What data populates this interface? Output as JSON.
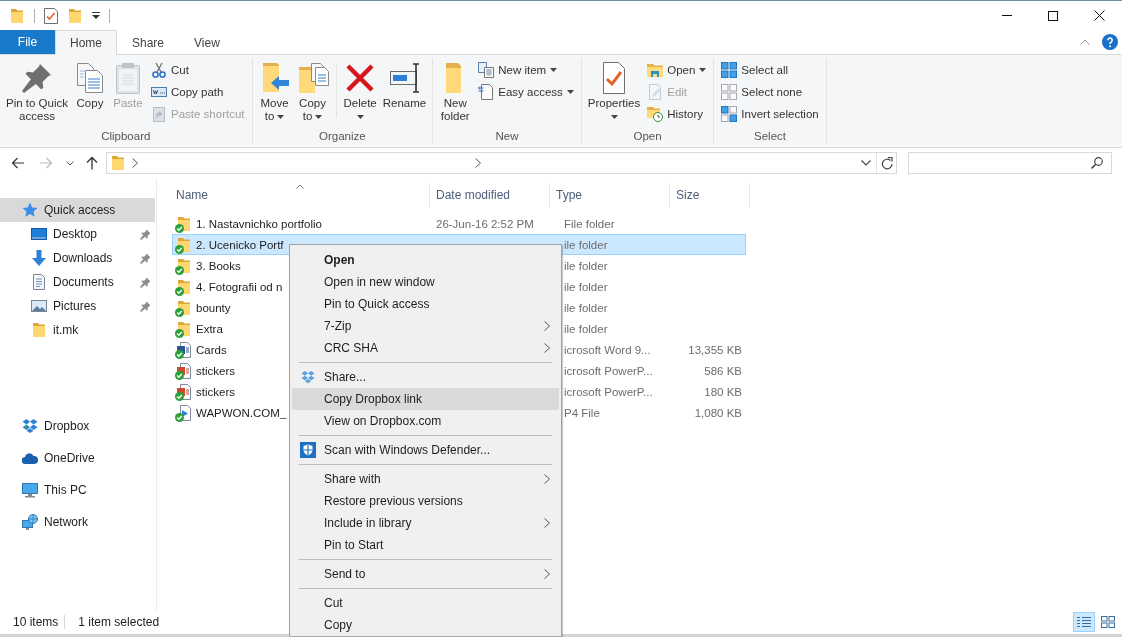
{
  "ribbon": {
    "tabs": [
      {
        "label": "File",
        "kind": "backstage",
        "selected": false
      },
      {
        "label": "Home",
        "kind": "tab",
        "selected": true
      },
      {
        "label": "Share",
        "kind": "tab",
        "selected": false
      },
      {
        "label": "View",
        "kind": "tab",
        "selected": false
      }
    ],
    "groups": [
      {
        "name": "Clipboard",
        "sections": [
          {
            "items": [
              {
                "label": "Pin to Quick access",
                "kind": "large",
                "disabled": false,
                "dropdown": false
              },
              {
                "label": "Copy",
                "kind": "large",
                "disabled": false,
                "dropdown": false
              },
              {
                "label": "Paste",
                "kind": "large",
                "disabled": true,
                "dropdown": false
              },
              {
                "label": "Cut",
                "kind": "small",
                "disabled": false,
                "dropdown": false
              },
              {
                "label": "Copy path",
                "kind": "small",
                "disabled": false,
                "dropdown": false
              },
              {
                "label": "Paste shortcut",
                "kind": "small",
                "disabled": true,
                "dropdown": false
              }
            ]
          }
        ]
      },
      {
        "name": "Organize",
        "sections": [
          {
            "items": [
              {
                "label": "Move to",
                "kind": "large",
                "disabled": false,
                "dropdown": true
              },
              {
                "label": "Copy to",
                "kind": "large",
                "disabled": false,
                "dropdown": true
              }
            ]
          },
          {
            "items": [
              {
                "label": "Delete",
                "kind": "large",
                "disabled": false,
                "dropdown": true
              },
              {
                "label": "Rename",
                "kind": "large",
                "disabled": false,
                "dropdown": false
              }
            ]
          }
        ]
      },
      {
        "name": "New",
        "sections": [
          {
            "items": [
              {
                "label": "New folder",
                "kind": "large",
                "disabled": false,
                "dropdown": false
              },
              {
                "label": "New item",
                "kind": "small",
                "disabled": false,
                "dropdown": true
              },
              {
                "label": "Easy access",
                "kind": "small",
                "disabled": false,
                "dropdown": true
              }
            ]
          }
        ]
      },
      {
        "name": "Open",
        "sections": [
          {
            "items": [
              {
                "label": "Properties",
                "kind": "large",
                "disabled": false,
                "dropdown": true
              },
              {
                "label": "Open",
                "kind": "small",
                "disabled": false,
                "dropdown": true
              },
              {
                "label": "Edit",
                "kind": "small",
                "disabled": true,
                "dropdown": false
              },
              {
                "label": "History",
                "kind": "small",
                "disabled": false,
                "dropdown": false
              }
            ]
          }
        ]
      },
      {
        "name": "Select",
        "sections": [
          {
            "items": [
              {
                "label": "Select all",
                "kind": "small",
                "disabled": false,
                "dropdown": false
              },
              {
                "label": "Select none",
                "kind": "small",
                "disabled": false,
                "dropdown": false
              },
              {
                "label": "Invert selection",
                "kind": "small",
                "disabled": false,
                "dropdown": false
              }
            ]
          }
        ]
      }
    ]
  },
  "navigation_pane": {
    "items": [
      {
        "label": "Quick access",
        "selected": true,
        "children": [
          {
            "label": "Desktop",
            "pinned": true,
            "selected": false
          },
          {
            "label": "Downloads",
            "pinned": true,
            "selected": false
          },
          {
            "label": "Documents",
            "pinned": true,
            "selected": false
          },
          {
            "label": "Pictures",
            "pinned": true,
            "selected": false
          },
          {
            "label": "it.mk",
            "pinned": false,
            "selected": false
          }
        ]
      },
      {
        "label": "Dropbox",
        "selected": false
      },
      {
        "label": "OneDrive",
        "selected": false
      },
      {
        "label": "This PC",
        "selected": false
      },
      {
        "label": "Network",
        "selected": false
      }
    ]
  },
  "file_list": {
    "columns": [
      {
        "label": "Name",
        "sorted": true
      },
      {
        "label": "Date modified",
        "sorted": false
      },
      {
        "label": "Type",
        "sorted": false
      },
      {
        "label": "Size",
        "sorted": false
      }
    ],
    "rows": [
      {
        "name": "1. Nastavnichko portfolio",
        "date": "26-Jun-16 2:52 PM",
        "type": "File folder",
        "kind": "folder",
        "synced": true,
        "selected": false
      },
      {
        "name": "2. Ucenicko Portf",
        "type": "ile folder",
        "kind": "folder",
        "synced": true,
        "selected": true
      },
      {
        "name": "3. Books",
        "type": "ile folder",
        "kind": "folder",
        "synced": true,
        "selected": false
      },
      {
        "name": "4. Fotografii od n",
        "type": "ile folder",
        "kind": "folder",
        "synced": true,
        "selected": false
      },
      {
        "name": "bounty",
        "type": "ile folder",
        "kind": "folder",
        "synced": true,
        "selected": false
      },
      {
        "name": "Extra",
        "type": "ile folder",
        "kind": "folder",
        "synced": true,
        "selected": false
      },
      {
        "name": "Cards",
        "type": "icrosoft Word 9...",
        "size": "13,355 KB",
        "kind": "document",
        "synced": true,
        "selected": false
      },
      {
        "name": "stickers",
        "type": "icrosoft PowerP...",
        "size": "586 KB",
        "kind": "presentation",
        "synced": true,
        "selected": false
      },
      {
        "name": "stickers",
        "type": "icrosoft PowerP...",
        "size": "180 KB",
        "kind": "presentation",
        "synced": true,
        "selected": false
      },
      {
        "name": "WAPWON.COM_",
        "type": "P4 File",
        "size": "1,080 KB",
        "kind": "video",
        "synced": true,
        "selected": false
      }
    ]
  },
  "context_menu": {
    "sections": [
      {
        "items": [
          {
            "label": "Open",
            "default": true,
            "submenu": false,
            "selected": false
          },
          {
            "label": "Open in new window",
            "default": false,
            "submenu": false,
            "selected": false
          },
          {
            "label": "Pin to Quick access",
            "default": false,
            "submenu": false,
            "selected": false
          },
          {
            "label": "7-Zip",
            "default": false,
            "submenu": true,
            "selected": false
          },
          {
            "label": "CRC SHA",
            "default": false,
            "submenu": true,
            "selected": false
          }
        ]
      },
      {
        "items": [
          {
            "label": "Share...",
            "default": false,
            "submenu": false,
            "selected": false
          },
          {
            "label": "Copy Dropbox link",
            "default": false,
            "submenu": false,
            "selected": true
          },
          {
            "label": "View on Dropbox.com",
            "default": false,
            "submenu": false,
            "selected": false
          }
        ]
      },
      {
        "items": [
          {
            "label": "Scan with Windows Defender...",
            "default": false,
            "submenu": false,
            "selected": false
          }
        ]
      },
      {
        "items": [
          {
            "label": "Share with",
            "default": false,
            "submenu": true,
            "selected": false
          },
          {
            "label": "Restore previous versions",
            "default": false,
            "submenu": false,
            "selected": false
          },
          {
            "label": "Include in library",
            "default": false,
            "submenu": true,
            "selected": false
          },
          {
            "label": "Pin to Start",
            "default": false,
            "submenu": false,
            "selected": false
          }
        ]
      },
      {
        "items": [
          {
            "label": "Send to",
            "default": false,
            "submenu": true,
            "selected": false
          }
        ]
      },
      {
        "items": [
          {
            "label": "Cut",
            "default": false,
            "submenu": false,
            "selected": false
          },
          {
            "label": "Copy",
            "default": false,
            "submenu": false,
            "selected": false
          }
        ]
      }
    ]
  },
  "status_bar": {
    "item_count": "10 items",
    "selection": "1 item selected",
    "views": [
      {
        "selected": true
      },
      {
        "selected": false
      }
    ]
  }
}
